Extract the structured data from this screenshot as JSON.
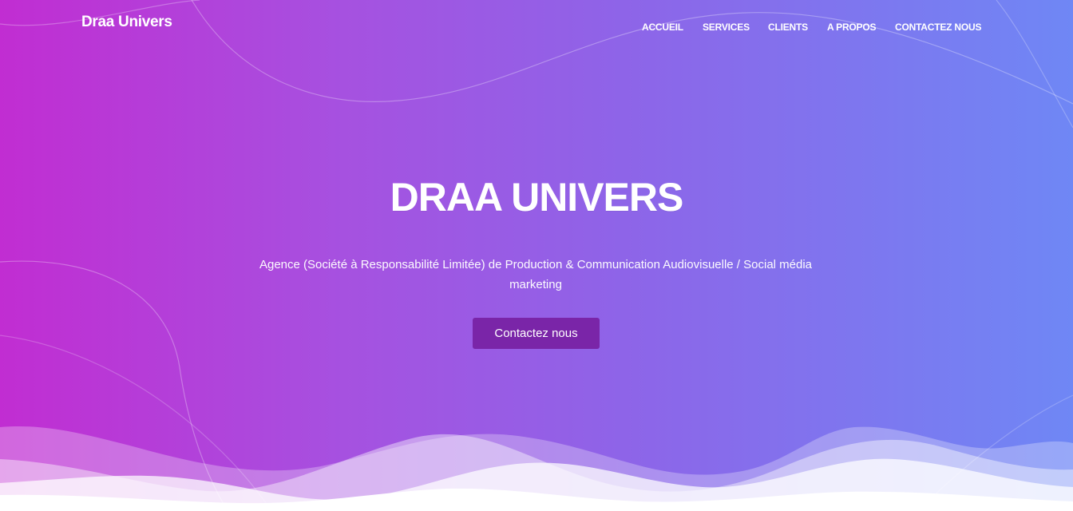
{
  "brand": {
    "name": "Draa Univers"
  },
  "nav": {
    "items": [
      {
        "label": "ACCUEIL"
      },
      {
        "label": "SERVICES"
      },
      {
        "label": "CLIENTS"
      },
      {
        "label": "A PROPOS"
      },
      {
        "label": "CONTACTEZ NOUS"
      }
    ]
  },
  "hero": {
    "title": "DRAA UNIVERS",
    "subtitle": "Agence (Société à Responsabilité Limitée) de Production & Communication Audiovisuelle / Social média marketing",
    "cta_label": "Contactez nous"
  },
  "colors": {
    "gradient_start": "#c12dd2",
    "gradient_end": "#6f87f5",
    "cta_background": "#7a25a8",
    "text": "#ffffff"
  }
}
